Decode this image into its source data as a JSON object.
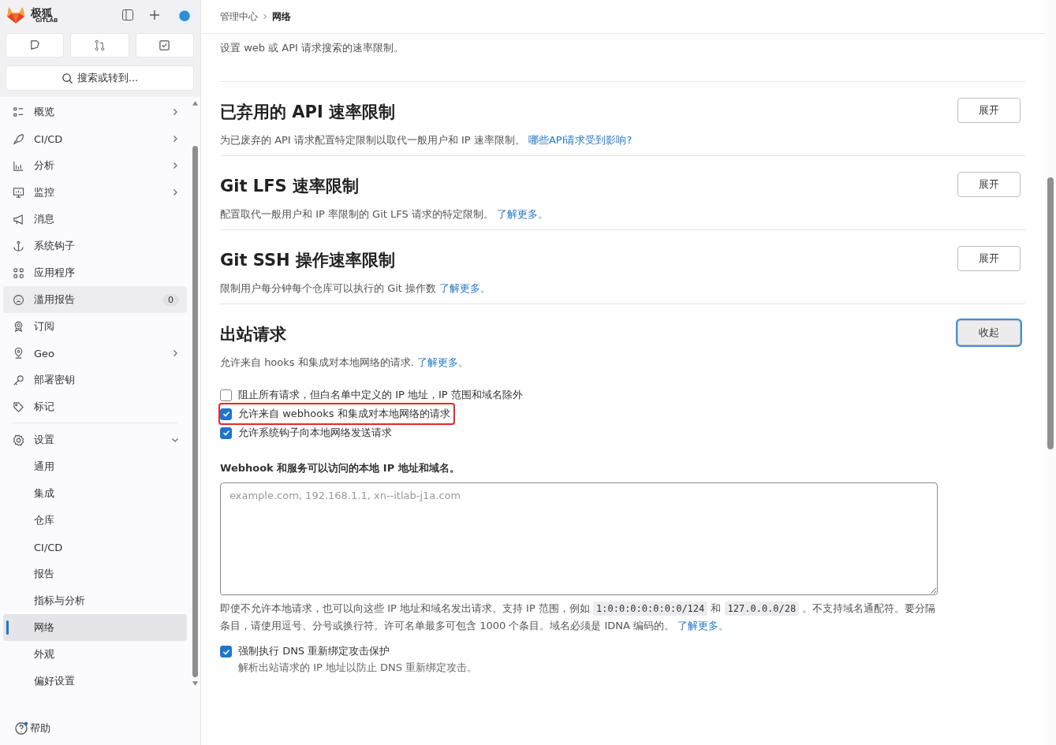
{
  "brand": {
    "name": "极狐",
    "sub": "GITLAB"
  },
  "search": {
    "placeholder": "搜索或转到..."
  },
  "sidebar": {
    "items": [
      {
        "label": "概览",
        "kind": "item",
        "expanded": false,
        "selected": false
      },
      {
        "label": "CI/CD",
        "kind": "item",
        "expanded": false,
        "selected": false
      },
      {
        "label": "分析",
        "kind": "item",
        "expanded": false,
        "selected": false
      },
      {
        "label": "监控",
        "kind": "item",
        "expanded": false,
        "selected": false
      },
      {
        "label": "消息",
        "kind": "item",
        "selected": false
      },
      {
        "label": "系统钩子",
        "kind": "item",
        "selected": false
      },
      {
        "label": "应用程序",
        "kind": "item",
        "selected": false
      },
      {
        "label": "滥用报告",
        "kind": "item",
        "badge": "0",
        "selected": false,
        "hovered": true
      },
      {
        "label": "订阅",
        "kind": "item",
        "selected": false
      },
      {
        "label": "Geo",
        "kind": "item",
        "expanded": false,
        "selected": false
      },
      {
        "label": "部署密钥",
        "kind": "item",
        "selected": false
      },
      {
        "label": "标记",
        "kind": "item",
        "selected": false
      },
      {
        "label": "设置",
        "kind": "item",
        "expanded": true,
        "selected": false,
        "divider_before": true
      },
      {
        "label": "通用",
        "kind": "sub",
        "selected": false
      },
      {
        "label": "集成",
        "kind": "sub",
        "selected": false
      },
      {
        "label": "仓库",
        "kind": "sub",
        "selected": false
      },
      {
        "label": "CI/CD",
        "kind": "sub",
        "selected": false
      },
      {
        "label": "报告",
        "kind": "sub",
        "selected": false
      },
      {
        "label": "指标与分析",
        "kind": "sub",
        "selected": false
      },
      {
        "label": "网络",
        "kind": "sub",
        "selected": true
      },
      {
        "label": "外观",
        "kind": "sub",
        "selected": false
      },
      {
        "label": "偏好设置",
        "kind": "sub",
        "selected": false
      }
    ],
    "help": "帮助"
  },
  "breadcrumb": [
    "管理中心",
    "网络"
  ],
  "intro": "设置 web 或 API 请求搜索的速率限制。",
  "sections": [
    {
      "title": "已弃用的 API 速率限制",
      "description": "为已废弃的 API 请求配置特定限制以取代一般用户和 IP 速率限制。",
      "link": "哪些API请求受到影响?",
      "button": "展开",
      "expanded": false
    },
    {
      "title": "Git LFS 速率限制",
      "description": "配置取代一般用户和 IP 率限制的 Git LFS 请求的特定限制。",
      "link": "了解更多。",
      "button": "展开",
      "expanded": false
    },
    {
      "title": "Git SSH 操作速率限制",
      "description": "限制用户每分钟每个仓库可以执行的 Git 操作数",
      "link": "了解更多。",
      "button": "展开",
      "expanded": false
    },
    {
      "title": "出站请求",
      "description": "允许来自 hooks 和集成对本地网络的请求.",
      "link": "了解更多。",
      "button": "收起",
      "expanded": true
    }
  ],
  "outbound": {
    "options": [
      {
        "label": "阻止所有请求，但白名单中定义的 IP 地址，IP 范围和域名除外",
        "checked": false,
        "highlighted": false
      },
      {
        "label": "允许来自 webhooks 和集成对本地网络的请求",
        "checked": true,
        "highlighted": true
      },
      {
        "label": "允许系统钩子向本地网络发送请求",
        "checked": true,
        "highlighted": false
      }
    ],
    "allowlist_label": "Webhook 和服务可以访问的本地 IP 地址和域名。",
    "allowlist_placeholder": "example.com, 192.168.1.1, xn--itlab-j1a.com",
    "help": [
      {
        "kind": "text",
        "text": "即使不允许本地请求，也可以向这些 IP 地址和域名发出请求。支持 IP 范围，例如 "
      },
      {
        "kind": "code",
        "text": "1:0:0:0:0:0:0:0/124"
      },
      {
        "kind": "text",
        "text": " 和 "
      },
      {
        "kind": "code",
        "text": "127.0.0.0/28"
      },
      {
        "kind": "text",
        "text": " 。不支持域名通配符。要分隔条目，请使用逗号、分号或换行符。许可名单最多可包含 1000 个条目。域名必须是 IDNA 编码的。 "
      },
      {
        "kind": "link",
        "text": "了解更多。"
      }
    ],
    "dns": {
      "label": "强制执行 DNS 重新绑定攻击保护",
      "description": "解析出站请求的 IP 地址以防止 DNS 重新绑定攻击。",
      "checked": true
    }
  }
}
